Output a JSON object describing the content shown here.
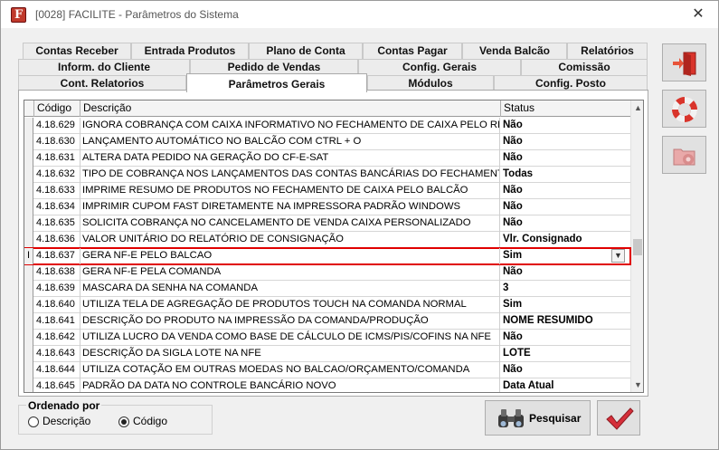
{
  "window": {
    "title": "[0028] FACILITE - Parâmetros do Sistema",
    "close_symbol": "✕",
    "app_icon_letter": "F"
  },
  "tabs": {
    "row1": [
      "Contas Receber",
      "Entrada Produtos",
      "Plano de Conta",
      "Contas Pagar",
      "Venda Balcão",
      "Relatórios"
    ],
    "row2": [
      "Inform. do Cliente",
      "Pedido de Vendas",
      "Config. Gerais",
      "Comissão"
    ],
    "row3": [
      "Cont. Relatorios",
      "Parâmetros Gerais",
      "Módulos",
      "Config. Posto"
    ],
    "active": "Parâmetros Gerais"
  },
  "grid": {
    "columns": [
      "Código",
      "Descrição",
      "Status"
    ],
    "rows": [
      {
        "code": "4.18.629",
        "desc": "IGNORA COBRANÇA COM CAIXA INFORMATIVO NO FECHAMENTO DE CAIXA PELO RETAGUARDA",
        "status": "Não"
      },
      {
        "code": "4.18.630",
        "desc": "LANÇAMENTO AUTOMÁTICO NO BALCÃO COM CTRL + O",
        "status": "Não"
      },
      {
        "code": "4.18.631",
        "desc": "ALTERA DATA PEDIDO NA GERAÇÃO DO CF-E-SAT",
        "status": "Não"
      },
      {
        "code": "4.18.632",
        "desc": "TIPO DE COBRANÇA NOS LANÇAMENTOS DAS CONTAS BANCÁRIAS DO FECHAMENTO DE CAIXA",
        "status": "Todas"
      },
      {
        "code": "4.18.633",
        "desc": "IMPRIME RESUMO DE PRODUTOS NO FECHAMENTO DE CAIXA PELO BALCÃO",
        "status": "Não"
      },
      {
        "code": "4.18.634",
        "desc": "IMPRIMIR CUPOM FAST DIRETAMENTE NA IMPRESSORA PADRÃO WINDOWS",
        "status": "Não"
      },
      {
        "code": "4.18.635",
        "desc": "SOLICITA COBRANÇA NO CANCELAMENTO DE VENDA CAIXA PERSONALIZADO",
        "status": "Não"
      },
      {
        "code": "4.18.636",
        "desc": "VALOR UNITÁRIO DO RELATÓRIO DE CONSIGNAÇÃO",
        "status": "Vlr. Consignado"
      },
      {
        "code": "4.18.637",
        "desc": "GERA NF-E PELO BALCAO",
        "status": "Sim",
        "selected": true,
        "indicator": "I"
      },
      {
        "code": "4.18.638",
        "desc": "GERA NF-E PELA COMANDA",
        "status": "Não"
      },
      {
        "code": "4.18.639",
        "desc": "MASCARA DA SENHA NA COMANDA",
        "status": "3"
      },
      {
        "code": "4.18.640",
        "desc": "UTILIZA TELA DE AGREGAÇÃO DE PRODUTOS TOUCH NA COMANDA NORMAL",
        "status": "Sim"
      },
      {
        "code": "4.18.641",
        "desc": "DESCRIÇÃO DO PRODUTO NA IMPRESSÃO DA COMANDA/PRODUÇÃO",
        "status": "NOME RESUMIDO"
      },
      {
        "code": "4.18.642",
        "desc": "UTILIZA LUCRO DA VENDA COMO BASE DE CÁLCULO DE ICMS/PIS/COFINS NA NFE",
        "status": "Não"
      },
      {
        "code": "4.18.643",
        "desc": "DESCRIÇÃO DA SIGLA LOTE NA NFE",
        "status": "LOTE"
      },
      {
        "code": "4.18.644",
        "desc": "UTILIZA COTAÇÃO EM OUTRAS MOEDAS NO BALCAO/ORÇAMENTO/COMANDA",
        "status": "Não"
      },
      {
        "code": "4.18.645",
        "desc": "PADRÃO DA DATA NO CONTROLE BANCÁRIO NOVO",
        "status": "Data Atual"
      }
    ]
  },
  "order": {
    "legend": "Ordenado por",
    "options": [
      "Descrição",
      "Código"
    ],
    "selected": "Código"
  },
  "buttons": {
    "search_label": "Pesquisar"
  },
  "colors": {
    "highlight": "#e00000",
    "exit_door": "#d9342b",
    "check": "#d62f3a"
  },
  "icons": [
    "exit-door-icon",
    "lifebuoy-icon",
    "settings-folder-icon",
    "binoculars-icon",
    "checkmark-icon",
    "chevron-down-icon",
    "chevron-up-icon",
    "close-icon"
  ]
}
